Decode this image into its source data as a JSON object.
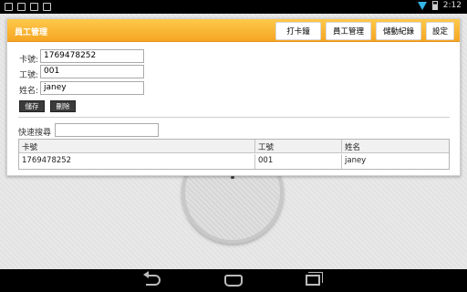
{
  "status_bar": {
    "time": "2:12",
    "left_icons": [
      "notification-icon",
      "image-icon",
      "mail-icon",
      "keyboard-icon"
    ],
    "wifi_color": "#33b5e5"
  },
  "header": {
    "title": "員工管理",
    "buttons": [
      "打卡鐘",
      "員工管理",
      "儲動紀錄",
      "設定"
    ],
    "accent": "#f5a623"
  },
  "form": {
    "card_label": "卡號:",
    "card_value": "1769478252",
    "emp_label": "工號:",
    "emp_value": "001",
    "name_label": "姓名:",
    "name_value": "janey",
    "save_label": "儲存",
    "delete_label": "刪除"
  },
  "search": {
    "label": "快速搜尋",
    "value": ""
  },
  "table": {
    "columns": [
      "卡號",
      "工號",
      "姓名"
    ],
    "rows": [
      [
        "1769478252",
        "001",
        "janey"
      ]
    ]
  }
}
